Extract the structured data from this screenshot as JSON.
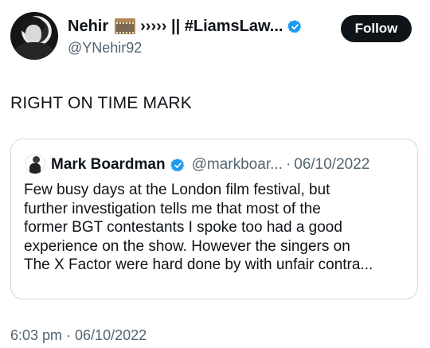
{
  "author": {
    "display_name_start": "Nehir",
    "display_name_rest": "›››››  || #LiamsLaw...",
    "handle": "@YNehir92",
    "follow_label": "Follow",
    "verified_color": "#1d9bf0"
  },
  "tweet": {
    "text": "RIGHT ON TIME MARK",
    "timestamp": "6:03 pm · 06/10/2022"
  },
  "quoted": {
    "name": "Mark Boardman",
    "handle": "@markboar...",
    "separator": "·",
    "date": "06/10/2022",
    "lines": [
      "Few busy days at the London film festival, but",
      "further investigation tells me that most of the",
      "former BGT contestants I spoke too had a good",
      "experience on the show. However the singers on",
      "The X Factor were hard done by with unfair contra..."
    ]
  },
  "colors": {
    "text_primary": "#0f1419",
    "text_secondary": "#536471",
    "border": "#cfd9de",
    "follow_bg": "#0f1419"
  }
}
